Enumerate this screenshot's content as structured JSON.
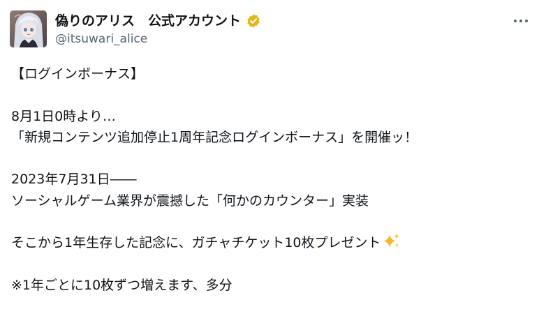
{
  "author": {
    "display_name": "偽りのアリス　公式アカウント",
    "handle": "@itsuwari_alice",
    "verified_badge_color": "#e2b719",
    "avatar_icon": "anime-character-avatar"
  },
  "tweet": {
    "header": "【ログインボーナス】",
    "line_1": "8月1日0時より…",
    "line_2": "「新規コンテンツ追加停止1周年記念ログインボーナス」を開催ッ！",
    "line_3": "2023年7月31日――",
    "line_4": "ソーシャルゲーム業界が震撼した「何かのカウンター」実装",
    "line_5": "そこから1年生存した記念に、ガチャチケット10枚プレゼント",
    "line_5_emoji": "sparkles-icon",
    "line_6": "※1年ごとに10枚ずつ増えます、多分"
  },
  "menu": {
    "icon": "more-horizontal-icon"
  },
  "colors": {
    "text": "#0f1419",
    "secondary": "#536471",
    "background": "#ffffff"
  }
}
